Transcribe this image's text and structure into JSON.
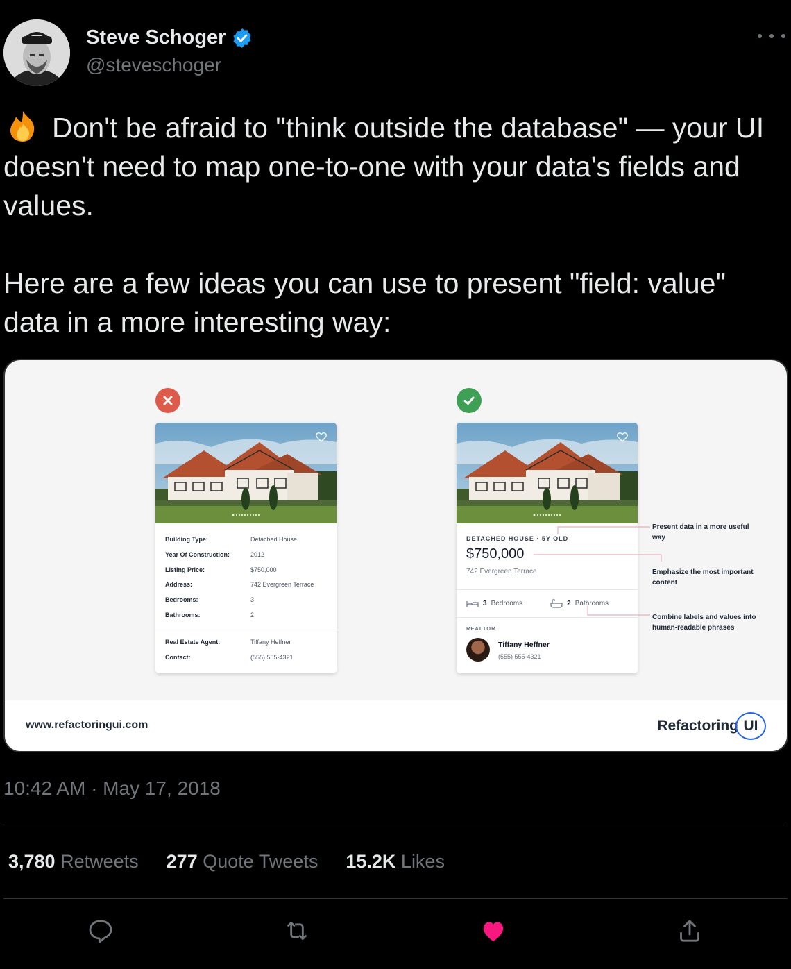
{
  "author": {
    "name": "Steve Schoger",
    "handle": "@steveschoger",
    "verified": true
  },
  "tweet": {
    "emoji": "fire",
    "line1": "Don't be afraid to \"think outside the database\" — your UI doesn't need to map one-to-one with your data's fields and values.",
    "line2": "Here are a few ideas you can use to present \"field: value\" data in a more interesting way:"
  },
  "media": {
    "footer_url": "www.refactoringui.com",
    "brand_text": "Refactoring",
    "brand_ui": "UI",
    "bad_card": {
      "fields": [
        {
          "label": "Building Type:",
          "value": "Detached House"
        },
        {
          "label": "Year Of Construction:",
          "value": "2012"
        },
        {
          "label": "Listing Price:",
          "value": "$750,000"
        },
        {
          "label": "Address:",
          "value": "742 Evergreen Terrace"
        },
        {
          "label": "Bedrooms:",
          "value": "3"
        },
        {
          "label": "Bathrooms:",
          "value": "2"
        }
      ],
      "agent_fields": [
        {
          "label": "Real Estate Agent:",
          "value": "Tiffany Heffner"
        },
        {
          "label": "Contact:",
          "value": "(555) 555-4321"
        }
      ]
    },
    "good_card": {
      "type_line": "DETACHED HOUSE · 5Y OLD",
      "price": "$750,000",
      "address": "742 Evergreen Terrace",
      "bedrooms_count": "3",
      "bedrooms_label": "Bedrooms",
      "bathrooms_count": "2",
      "bathrooms_label": "Bathrooms",
      "realtor_label": "REALTOR",
      "agent_name": "Tiffany Heffner",
      "agent_phone": "(555) 555-4321"
    },
    "annotations": [
      "Present data in a more useful way",
      "Emphasize the most important content",
      "Combine labels and values into human-readable phrases"
    ]
  },
  "timestamp": "10:42 AM · May 17, 2018",
  "stats": {
    "retweets_count": "3,780",
    "retweets_label": "Retweets",
    "quotes_count": "277",
    "quotes_label": "Quote Tweets",
    "likes_count": "15.2K",
    "likes_label": "Likes"
  },
  "colors": {
    "background": "#000000",
    "text": "#e7e9ea",
    "muted": "#71767b",
    "verified": "#1d9bf0",
    "like": "#f91880",
    "annotation_line": "#e89aa8"
  },
  "icons": [
    "reply-icon",
    "retweet-icon",
    "like-icon",
    "share-icon"
  ]
}
